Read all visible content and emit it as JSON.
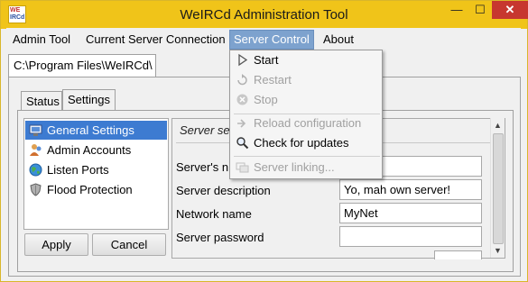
{
  "window": {
    "title": "WeIRCd Administration Tool",
    "icon_top": "WE",
    "icon_bottom": "IRCd"
  },
  "window_controls": {
    "minimize": "—",
    "maximize": "☐",
    "close": "✕"
  },
  "menu": {
    "items": [
      {
        "label": "Admin Tool"
      },
      {
        "label": "Current Server Connection"
      },
      {
        "label": "Server Control"
      },
      {
        "label": "About"
      }
    ]
  },
  "path_tab": {
    "label": "C:\\Program Files\\WeIRCd\\"
  },
  "tabs": [
    {
      "label": "Status"
    },
    {
      "label": "Settings"
    }
  ],
  "settings_list": [
    {
      "label": "General Settings",
      "icon": "computer-icon"
    },
    {
      "label": "Admin Accounts",
      "icon": "users-icon"
    },
    {
      "label": "Listen Ports",
      "icon": "globe-icon"
    },
    {
      "label": "Flood Protection",
      "icon": "shield-icon"
    }
  ],
  "buttons": {
    "apply": "Apply",
    "cancel": "Cancel"
  },
  "section": {
    "title": "Server se"
  },
  "fields": [
    {
      "label": "Server's n",
      "value": "et.net"
    },
    {
      "label": "Server description",
      "value": "Yo, mah own server!"
    },
    {
      "label": "Network name",
      "value": "MyNet"
    },
    {
      "label": "Server password",
      "value": ""
    }
  ],
  "server_control_menu": [
    {
      "label": "Start",
      "enabled": true,
      "icon": "play-icon"
    },
    {
      "label": "Restart",
      "enabled": false,
      "icon": "restart-icon"
    },
    {
      "label": "Stop",
      "enabled": false,
      "icon": "stop-icon"
    },
    {
      "label": "Reload configuration",
      "enabled": false,
      "icon": "reload-icon"
    },
    {
      "label": "Check for updates",
      "enabled": true,
      "icon": "magnifier-icon"
    },
    {
      "label": "Server linking...",
      "enabled": false,
      "icon": "link-icon"
    }
  ],
  "colors": {
    "titlebar": "#f0c419",
    "selection": "#3d7bd1",
    "menu_active": "#7da2ce",
    "close": "#c7372f"
  }
}
